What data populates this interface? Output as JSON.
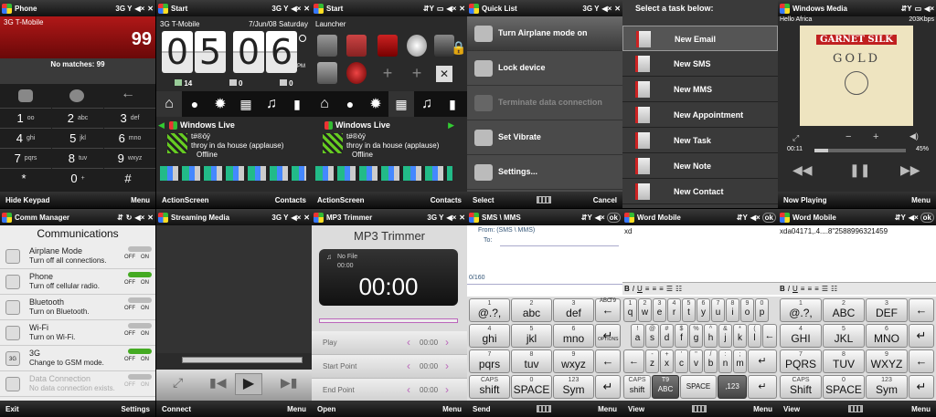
{
  "p1": {
    "title": "Phone",
    "carrier": "3G T-Mobile",
    "count": "99",
    "nomatch": "No matches: 99",
    "keys": [
      [
        "1",
        "oo"
      ],
      [
        "2",
        "abc"
      ],
      [
        "3",
        "def"
      ],
      [
        "4",
        "ghi"
      ],
      [
        "5",
        "jkl"
      ],
      [
        "6",
        "mno"
      ],
      [
        "7",
        "pqrs"
      ],
      [
        "8",
        "tuv"
      ],
      [
        "9",
        "wxyz"
      ],
      [
        "*",
        ""
      ],
      [
        "0",
        "+"
      ],
      [
        "#",
        ""
      ]
    ],
    "left": "Hide Keypad",
    "right": "Menu"
  },
  "p2": {
    "title": "Start",
    "carrier": "3G T-Mobile",
    "date": "7/Jun/08 Saturday",
    "h1": "0",
    "h2": "5",
    "m1": "0",
    "m2": "6",
    "pm": "PM",
    "c1": "14",
    "c2": "0",
    "c3": "0",
    "live": "Windows Live",
    "nick": "t#®ōÿ",
    "status1": "throy in da house (applause)",
    "status2": "Offline",
    "left": "ActionScreen",
    "right": "Contacts"
  },
  "p3": {
    "title": "Start",
    "launcher": "Launcher",
    "live": "Windows Live",
    "nick": "t#®ōÿ",
    "status1": "throy in da house (applause)",
    "status2": "Offline",
    "left": "ActionScreen",
    "right": "Contacts"
  },
  "p4": {
    "title": "Quick List",
    "items": [
      "Turn Airplane mode on",
      "Lock device",
      "Terminate data connection",
      "Set Vibrate",
      "Settings..."
    ],
    "left": "Select",
    "right": "Cancel"
  },
  "p5": {
    "title": "Select a task below:",
    "items": [
      "New Email",
      "New SMS",
      "New MMS",
      "New Appointment",
      "New Task",
      "New Note",
      "New Contact"
    ]
  },
  "p6": {
    "title": "Windows Media",
    "line1": "Hello Africa",
    "kbps": "203Kbps",
    "album_artist": "GARNET SILK",
    "album_title": "GOLD",
    "time": "00:11",
    "vol": "45%",
    "left": "Now Playing",
    "right": "Menu"
  },
  "p7": {
    "title": "Comm Manager",
    "heading": "Communications",
    "items": [
      {
        "name": "Airplane Mode",
        "desc": "Turn off all connections.",
        "state": "off",
        "on": "ON",
        "off": "OFF"
      },
      {
        "name": "Phone",
        "desc": "Turn off cellular radio.",
        "state": "on",
        "on": "ON",
        "off": "OFF"
      },
      {
        "name": "Bluetooth",
        "desc": "Turn on Bluetooth.",
        "state": "off",
        "on": "ON",
        "off": "OFF"
      },
      {
        "name": "Wi-Fi",
        "desc": "Turn on Wi-Fi.",
        "state": "off",
        "on": "ON",
        "off": "OFF"
      },
      {
        "name": "3G",
        "desc": "Change to GSM mode.",
        "state": "on",
        "on": "ON",
        "off": "OFF"
      },
      {
        "name": "Data Connection",
        "desc": "No data connection exists.",
        "state": "disabled",
        "on": "ON",
        "off": "OFF"
      }
    ],
    "icon3g": "3G",
    "left": "Exit",
    "right": "Settings"
  },
  "p8": {
    "title": "Streaming Media",
    "left": "Connect",
    "right": "Menu"
  },
  "p9": {
    "title": "MP3 Trimmer",
    "heading": "MP3 Trimmer",
    "nofile": "No File",
    "small_time": "00:00",
    "big_time": "00:00",
    "rows": [
      {
        "label": "Play",
        "time": "00:00"
      },
      {
        "label": "Start Point",
        "time": "00:00"
      },
      {
        "label": "End Point",
        "time": "00:00"
      }
    ],
    "left": "Open",
    "right": "Menu"
  },
  "p10": {
    "title": "SMS \\ MMS",
    "from": "From: (SMS \\ MMS)",
    "to": "To:",
    "counter": "0/160",
    "left": "Send",
    "right": "Menu",
    "keys": [
      [
        "1",
        "@.?,"
      ],
      [
        "2",
        "abc"
      ],
      [
        "3",
        "def"
      ],
      [
        "4",
        "ghi"
      ],
      [
        "5",
        "jkl"
      ],
      [
        "6",
        "mno"
      ],
      [
        "7",
        "pqrs"
      ],
      [
        "8",
        "tuv"
      ],
      [
        "9",
        "wxyz"
      ],
      [
        "CAPS",
        "shift"
      ],
      [
        "0",
        "SPACE"
      ],
      [
        "123",
        "Sym"
      ]
    ],
    "abc": "ABC",
    "t9": "T9",
    "options": "OPTIONS"
  },
  "p11": {
    "title": "Word Mobile",
    "text": "xd",
    "fmt": [
      "B",
      "I",
      "U"
    ],
    "rows": [
      [
        "q",
        "w",
        "e",
        "r",
        "t",
        "y",
        "u",
        "i",
        "o",
        "p"
      ],
      [
        "a",
        "s",
        "d",
        "f",
        "g",
        "h",
        "j",
        "k",
        "l"
      ],
      [
        "z",
        "x",
        "c",
        "v",
        "b",
        "n",
        "m"
      ]
    ],
    "subs": [
      [
        "1",
        "2",
        "3",
        "4",
        "5",
        "6",
        "7",
        "8",
        "9",
        "0"
      ],
      [
        "!",
        "@",
        "#",
        "$",
        "%",
        "^",
        "&",
        "*",
        "("
      ],
      [
        "-",
        "+",
        "'",
        "\"",
        "/",
        ":",
        ";"
      ]
    ],
    "caps": "CAPS",
    "shift": "shift",
    "t9": "T9",
    "abc": "ABC",
    "space": "SPACE",
    "sym": ",123",
    "left": "View",
    "right": "Menu"
  },
  "p12": {
    "title": "Word Mobile",
    "text": "xda04171,.4....8\"2588996321459",
    "fmt": [
      "B",
      "I",
      "U"
    ],
    "keys": [
      [
        "1",
        "@.?,"
      ],
      [
        "2",
        "ABC"
      ],
      [
        "3",
        "DEF"
      ],
      [
        "4",
        "GHI"
      ],
      [
        "5",
        "JKL"
      ],
      [
        "6",
        "MNO"
      ],
      [
        "7",
        "PQRS"
      ],
      [
        "8",
        "TUV"
      ],
      [
        "9",
        "WXYZ"
      ],
      [
        "CAPS",
        "Shift"
      ],
      [
        "0",
        "SPACE"
      ],
      [
        "123",
        "Sym"
      ]
    ],
    "left": "View",
    "right": "Menu"
  }
}
